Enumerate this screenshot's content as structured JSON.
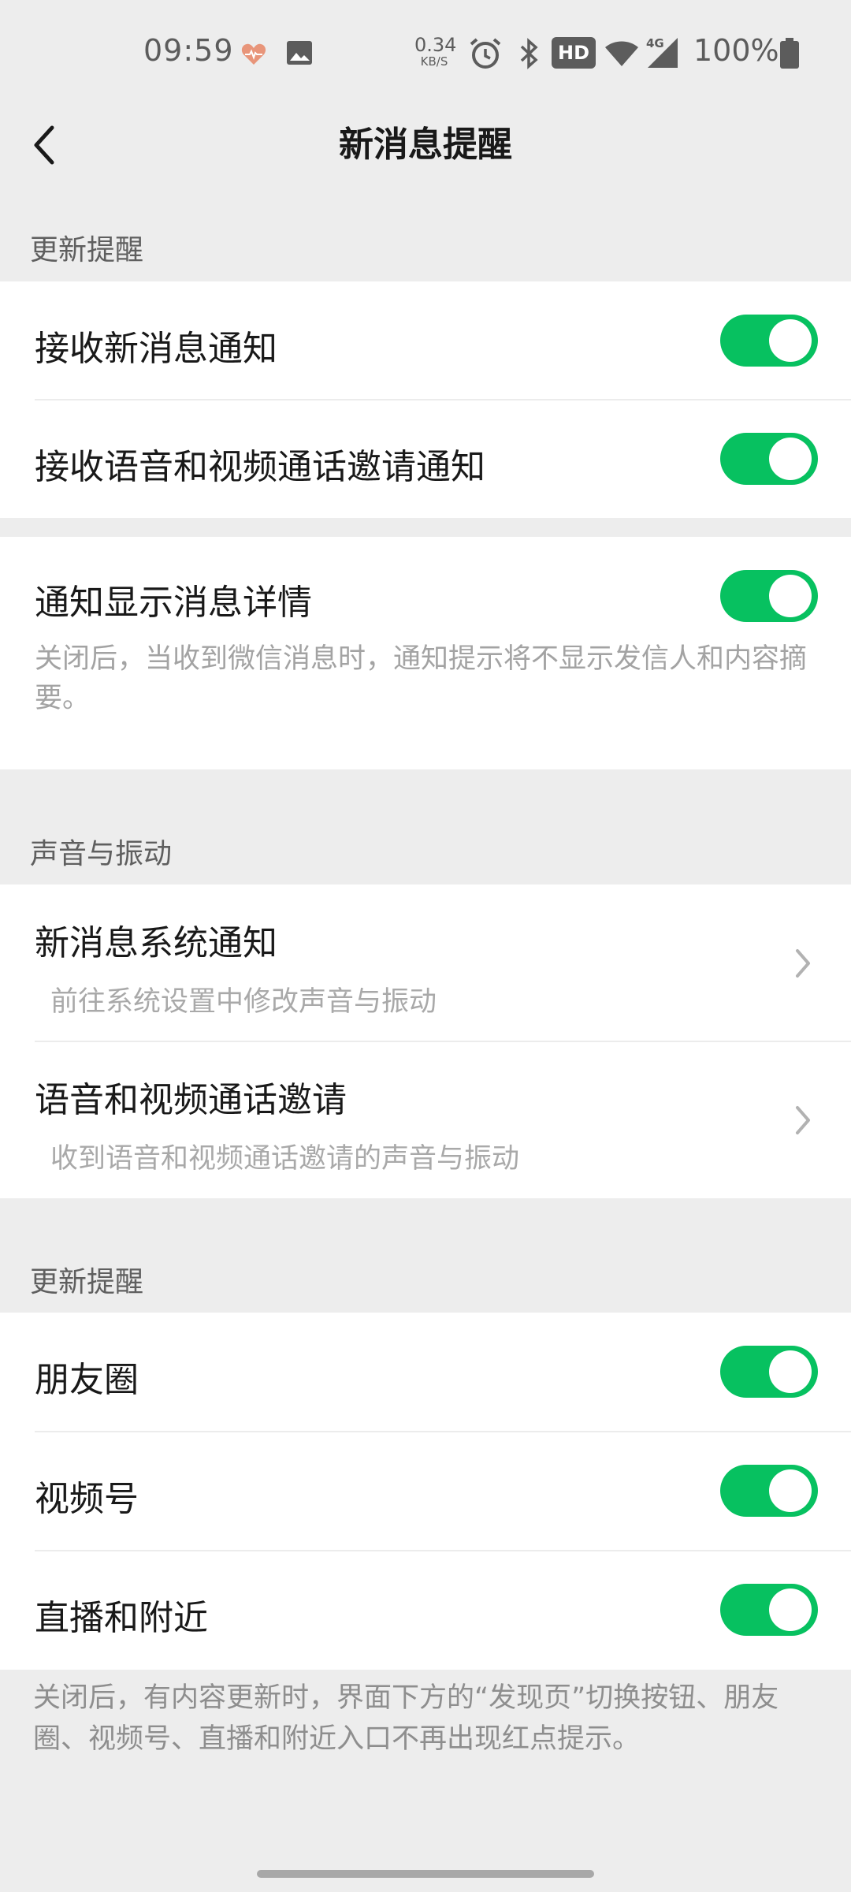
{
  "status_bar": {
    "time": "09:59",
    "net_speed_value": "0.34",
    "net_speed_unit": "KB/S",
    "hd_badge": "HD",
    "network": "4G",
    "battery_text": "100%",
    "icons": [
      "heart-health-icon",
      "image-icon",
      "alarm-icon",
      "bluetooth-icon",
      "wifi-icon",
      "cell-signal-icon",
      "battery-icon"
    ]
  },
  "nav": {
    "title": "新消息提醒",
    "back_icon": "chevron-left-icon"
  },
  "sections": {
    "updates_title": "更新提醒",
    "sound_title": "声音与振动",
    "feed_title": "更新提醒"
  },
  "settings": {
    "receive_new_msg": {
      "label": "接收新消息通知",
      "on": true
    },
    "receive_call_invite": {
      "label": "接收语音和视频通话邀请通知",
      "on": true
    },
    "show_details": {
      "label": "通知显示消息详情",
      "on": true,
      "description": "关闭后，当收到微信消息时，通知提示将不显示发信人和内容摘要。"
    },
    "system_notify": {
      "label": "新消息系统通知",
      "sub": "前往系统设置中修改声音与振动"
    },
    "call_invite_sound": {
      "label": "语音和视频通话邀请",
      "sub": "收到语音和视频通话邀请的声音与振动"
    },
    "moments": {
      "label": "朋友圈",
      "on": true
    },
    "channels": {
      "label": "视频号",
      "on": true
    },
    "live_nearby": {
      "label": "直播和附近",
      "on": true
    },
    "feed_description": "关闭后，有内容更新时，界面下方的“发现页”切换按钮、朋友圈、视频号、直播和附近入口不再出现红点提示。"
  },
  "colors": {
    "toggle_on": "#07c160",
    "background": "#ededed",
    "card": "#ffffff"
  }
}
